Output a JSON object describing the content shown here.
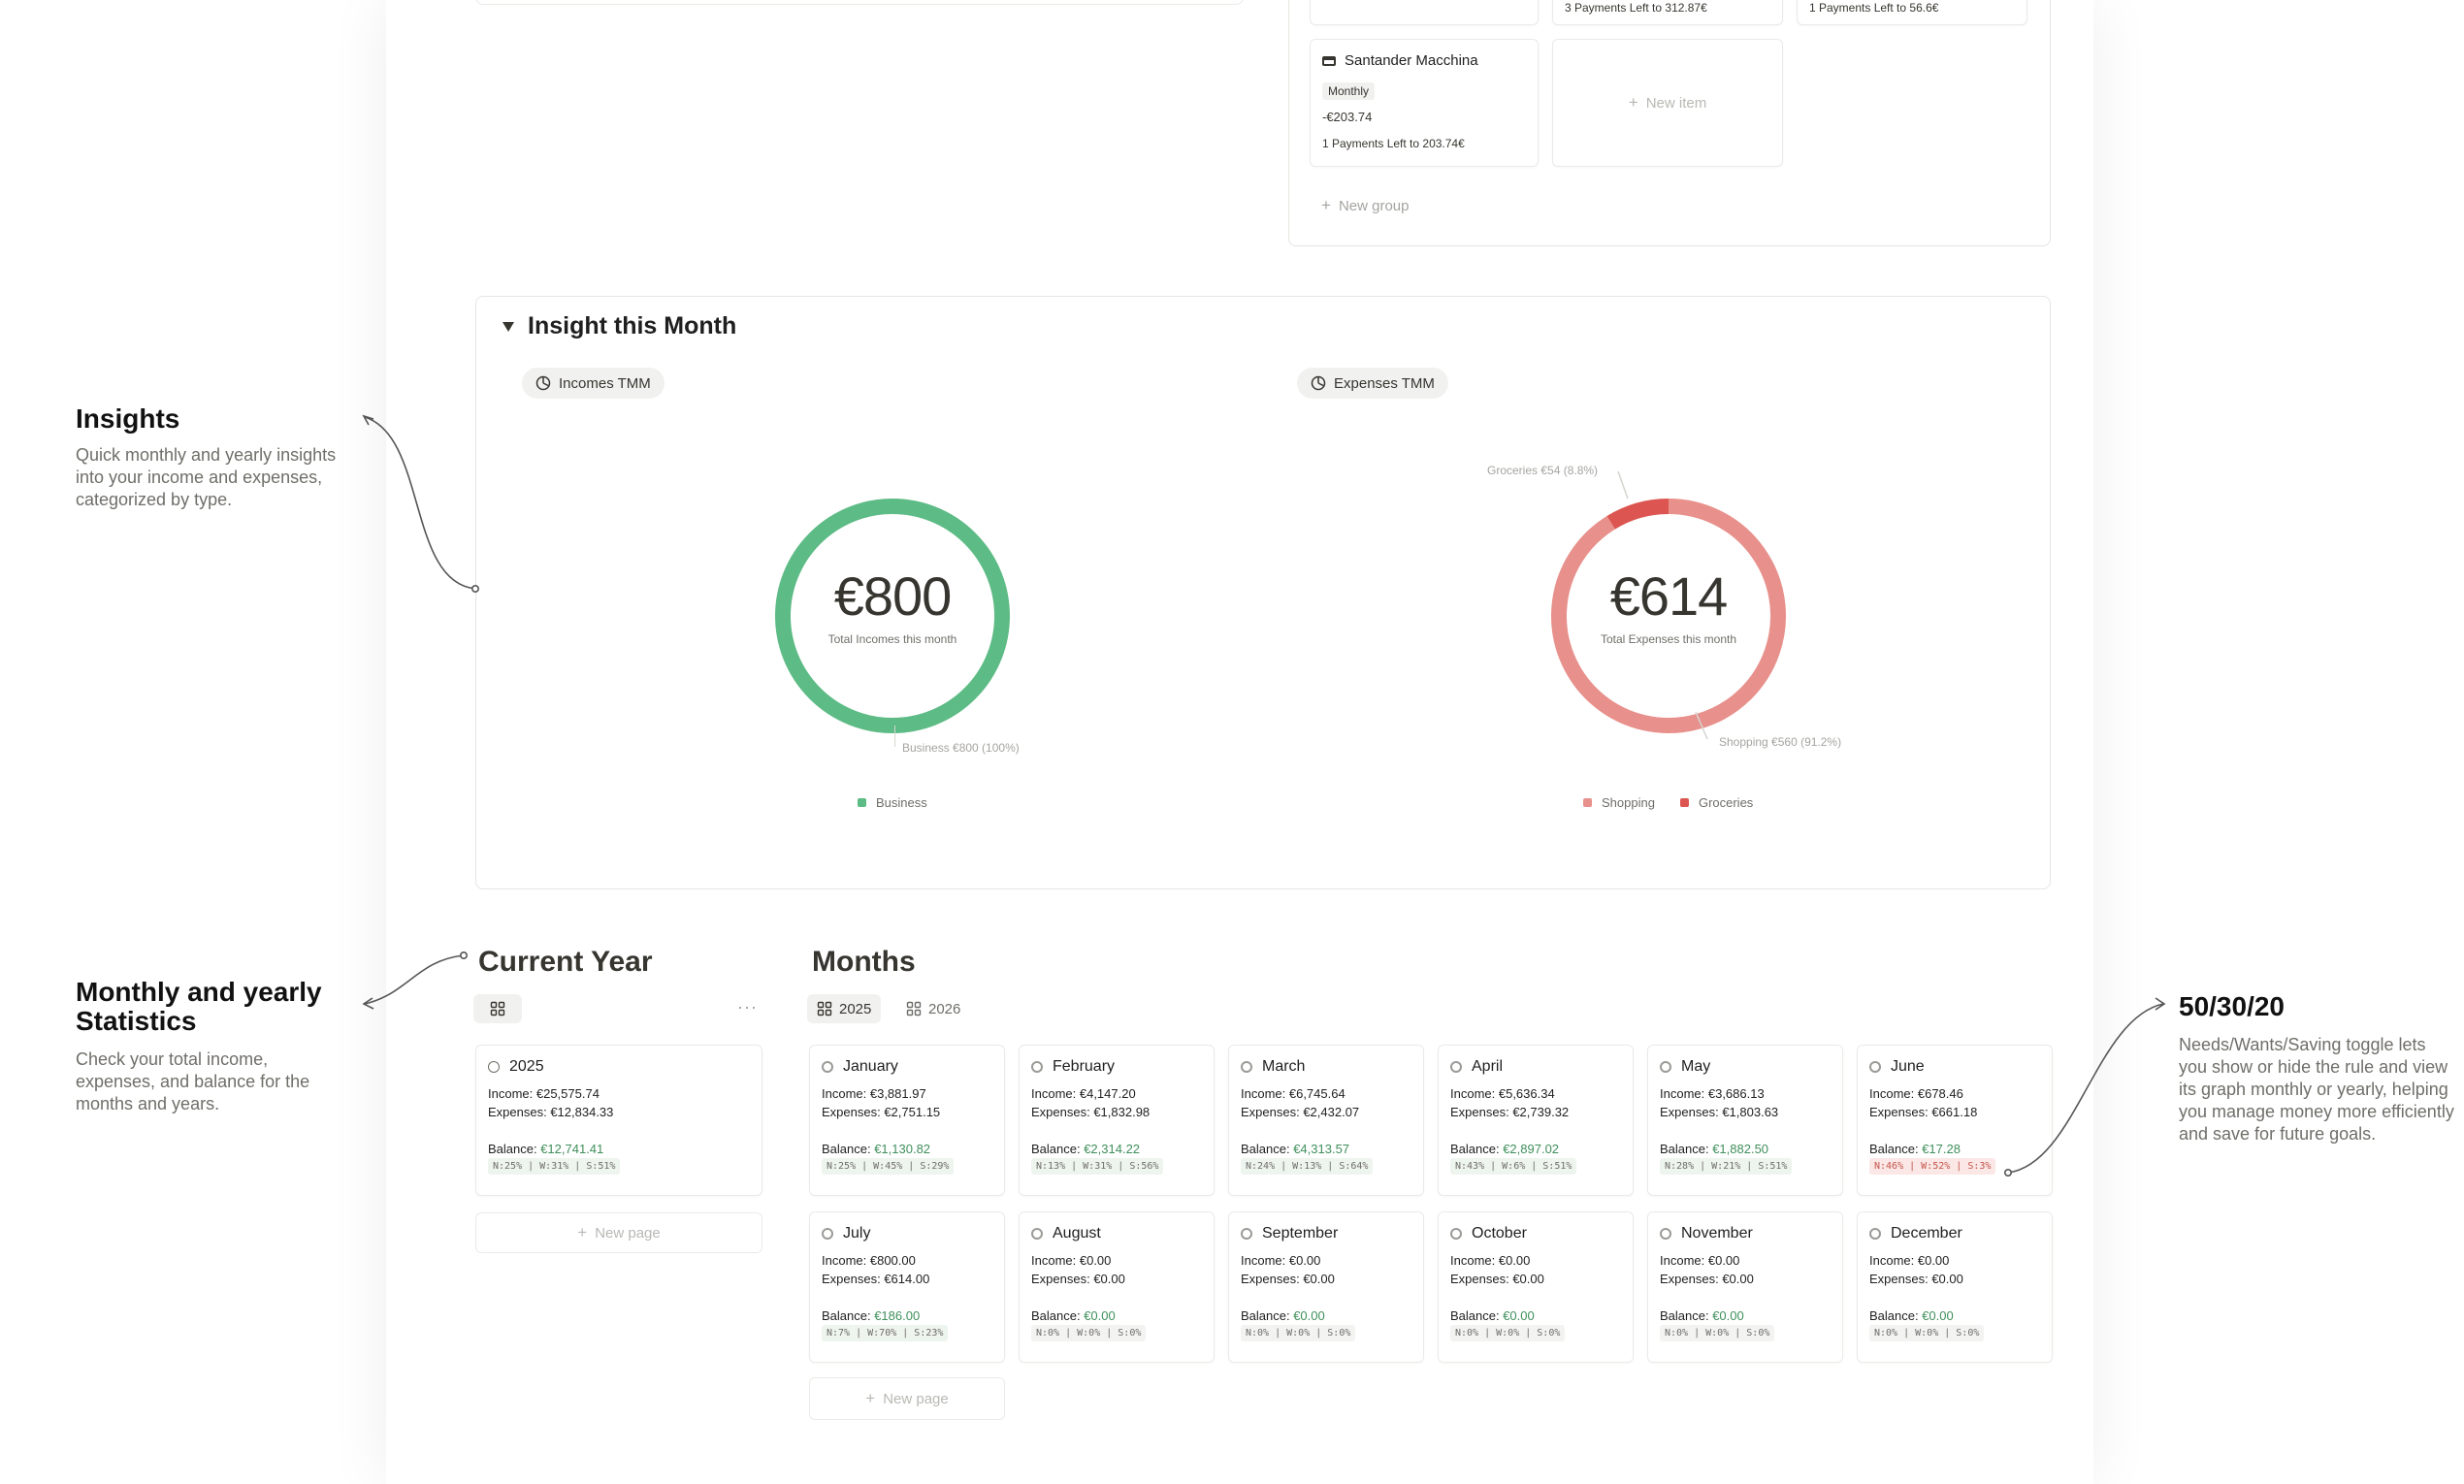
{
  "annotations": {
    "insights": {
      "title": "Insights",
      "desc": "Quick monthly and yearly insights into your income and expenses, categorized by type."
    },
    "stats": {
      "title": "Monthly and yearly Statistics",
      "desc": "Check your total income, expenses, and balance for the months and years."
    },
    "rule": {
      "title": "50/30/20",
      "desc": "Needs/Wants/Saving toggle lets you show or hide the rule and view its graph monthly or yearly, helping you manage money more efficiently and save for future goals."
    }
  },
  "debts": {
    "top_partial": [
      "3 Payments Left to 312.87€",
      "1 Payments Left to 56.6€"
    ],
    "card": {
      "name": "Santander Macchina",
      "tag": "Monthly",
      "amount": "-€203.74",
      "left": "1 Payments Left to 203.74€"
    },
    "new_item": "New item",
    "new_group": "New group"
  },
  "insight": {
    "title": "Insight this Month",
    "incomes": {
      "tab": "Incomes TMM",
      "total": "€800",
      "subtitle": "Total Incomes this month",
      "label": "Business €800 (100%)",
      "legend": [
        "Business"
      ]
    },
    "expenses": {
      "tab": "Expenses TMM",
      "total": "€614",
      "subtitle": "Total Expenses this month",
      "label_small": "Groceries €54 (8.8%)",
      "label_big": "Shopping €560 (91.2%)",
      "legend": [
        "Shopping",
        "Groceries"
      ]
    }
  },
  "chart_data": [
    {
      "type": "pie",
      "title": "Incomes TMM",
      "categories": [
        "Business"
      ],
      "values": [
        800
      ],
      "colors": [
        "#5dbb85"
      ]
    },
    {
      "type": "pie",
      "title": "Expenses TMM",
      "categories": [
        "Shopping",
        "Groceries"
      ],
      "values": [
        560,
        54
      ],
      "colors": [
        "#e8908b",
        "#dc5550"
      ]
    }
  ],
  "current_year": {
    "title": "Current Year",
    "card": {
      "name": "2025",
      "income": "Income: €25,575.74",
      "expenses": "Expenses: €12,834.33",
      "balance_label": "Balance: ",
      "balance": "€12,741.41",
      "nws": "N:25% | W:31% | S:51%"
    },
    "new_page": "New page"
  },
  "months": {
    "title": "Months",
    "tabs": [
      "2025",
      "2026"
    ],
    "new_page": "New page",
    "balance_label": "Balance: ",
    "items": [
      {
        "name": "January",
        "income": "Income: €3,881.97",
        "expenses": "Expenses: €2,751.15",
        "balance": "€1,130.82",
        "nws": "N:25% | W:45% | S:29%",
        "style": "green"
      },
      {
        "name": "February",
        "income": "Income: €4,147.20",
        "expenses": "Expenses: €1,832.98",
        "balance": "€2,314.22",
        "nws": "N:13% | W:31% | S:56%",
        "style": "green"
      },
      {
        "name": "March",
        "income": "Income: €6,745.64",
        "expenses": "Expenses: €2,432.07",
        "balance": "€4,313.57",
        "nws": "N:24% | W:13% | S:64%",
        "style": "green"
      },
      {
        "name": "April",
        "income": "Income: €5,636.34",
        "expenses": "Expenses: €2,739.32",
        "balance": "€2,897.02",
        "nws": "N:43% | W:6% | S:51%",
        "style": "green"
      },
      {
        "name": "May",
        "income": "Income: €3,686.13",
        "expenses": "Expenses: €1,803.63",
        "balance": "€1,882.50",
        "nws": "N:28% | W:21% | S:51%",
        "style": "green"
      },
      {
        "name": "June",
        "income": "Income: €678.46",
        "expenses": "Expenses: €661.18",
        "balance": "€17.28",
        "nws": "N:46% | W:52% | S:3%",
        "style": "red"
      },
      {
        "name": "July",
        "income": "Income: €800.00",
        "expenses": "Expenses: €614.00",
        "balance": "€186.00",
        "nws": "N:7% | W:70% | S:23%",
        "style": "green"
      },
      {
        "name": "August",
        "income": "Income: €0.00",
        "expenses": "Expenses: €0.00",
        "balance": "€0.00",
        "nws": "N:0% | W:0% | S:0%",
        "style": "plain"
      },
      {
        "name": "September",
        "income": "Income: €0.00",
        "expenses": "Expenses: €0.00",
        "balance": "€0.00",
        "nws": "N:0% | W:0% | S:0%",
        "style": "plain"
      },
      {
        "name": "October",
        "income": "Income: €0.00",
        "expenses": "Expenses: €0.00",
        "balance": "€0.00",
        "nws": "N:0% | W:0% | S:0%",
        "style": "plain"
      },
      {
        "name": "November",
        "income": "Income: €0.00",
        "expenses": "Expenses: €0.00",
        "balance": "€0.00",
        "nws": "N:0% | W:0% | S:0%",
        "style": "plain"
      },
      {
        "name": "December",
        "income": "Income: €0.00",
        "expenses": "Expenses: €0.00",
        "balance": "€0.00",
        "nws": "N:0% | W:0% | S:0%",
        "style": "plain"
      }
    ]
  }
}
